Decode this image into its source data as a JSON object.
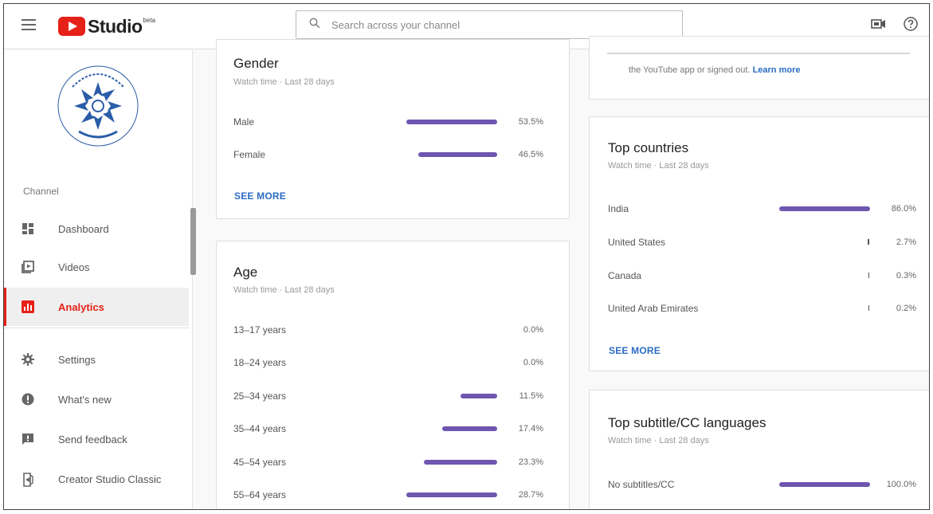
{
  "header": {
    "logo_text": "Studio",
    "logo_badge": "beta",
    "search_placeholder": "Search across your channel"
  },
  "sidebar": {
    "channel_label": "Channel",
    "items": [
      {
        "label": "Dashboard",
        "icon": "dashboard-icon"
      },
      {
        "label": "Videos",
        "icon": "videos-icon"
      },
      {
        "label": "Analytics",
        "icon": "analytics-icon",
        "active": true
      },
      {
        "label": "Settings",
        "icon": "gear-icon"
      },
      {
        "label": "What's new",
        "icon": "whats-new-icon"
      },
      {
        "label": "Send feedback",
        "icon": "feedback-icon"
      },
      {
        "label": "Creator Studio Classic",
        "icon": "classic-studio-icon"
      }
    ]
  },
  "gender": {
    "title": "Gender",
    "subtitle": "Watch time · Last 28 days",
    "rows": [
      {
        "label": "Male",
        "value": "53.5%",
        "pct": 53.5
      },
      {
        "label": "Female",
        "value": "46.5%",
        "pct": 46.5
      }
    ],
    "see_more": "SEE MORE"
  },
  "age": {
    "title": "Age",
    "subtitle": "Watch time · Last 28 days",
    "rows": [
      {
        "label": "13–17 years",
        "value": "0.0%",
        "pct": 0.0
      },
      {
        "label": "18–24 years",
        "value": "0.0%",
        "pct": 0.0
      },
      {
        "label": "25–34 years",
        "value": "11.5%",
        "pct": 11.5
      },
      {
        "label": "35–44 years",
        "value": "17.4%",
        "pct": 17.4
      },
      {
        "label": "45–54 years",
        "value": "23.3%",
        "pct": 23.3
      },
      {
        "label": "55–64 years",
        "value": "28.7%",
        "pct": 28.7
      }
    ]
  },
  "notice": {
    "text": "the YouTube app or signed out.",
    "link": "Learn more"
  },
  "countries": {
    "title": "Top countries",
    "subtitle": "Watch time · Last 28 days",
    "rows": [
      {
        "label": "India",
        "value": "86.0%",
        "pct": 86.0
      },
      {
        "label": "United States",
        "value": "2.7%",
        "pct": 2.7
      },
      {
        "label": "Canada",
        "value": "0.3%",
        "pct": 0.3
      },
      {
        "label": "United Arab Emirates",
        "value": "0.2%",
        "pct": 0.2
      }
    ],
    "see_more": "SEE MORE"
  },
  "subtitles": {
    "title": "Top subtitle/CC languages",
    "subtitle": "Watch time · Last 28 days",
    "rows": [
      {
        "label": "No subtitles/CC",
        "value": "100.0%",
        "pct": 100.0
      }
    ]
  },
  "colors": {
    "accent": "#e62117",
    "bar": "#6f56b0",
    "link": "#2b6cc4"
  }
}
